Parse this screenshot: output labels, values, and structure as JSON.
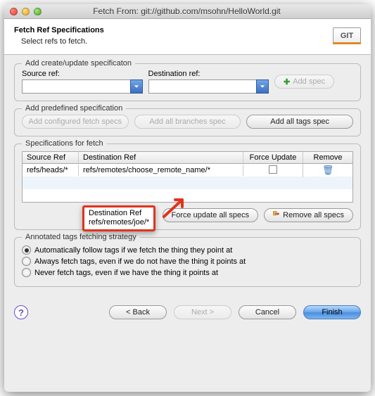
{
  "window": {
    "title": "Fetch From: git://github.com/msohn/HelloWorld.git"
  },
  "header": {
    "title": "Fetch Ref Specifications",
    "subtitle": "Select refs to fetch."
  },
  "groups": {
    "create_update": {
      "label": "Add create/update specificaton",
      "source_ref_label": "Source ref:",
      "destination_ref_label": "Destination ref:",
      "source_ref_value": "",
      "destination_ref_value": "",
      "add_spec_label": "Add spec"
    },
    "predefined": {
      "label": "Add predefined specification",
      "buttons": [
        "Add configured fetch specs",
        "Add all branches spec",
        "Add all tags spec"
      ]
    },
    "specs": {
      "label": "Specifications for fetch",
      "columns": [
        "Source Ref",
        "Destination Ref",
        "Force Update",
        "Remove"
      ],
      "rows": [
        {
          "source": "refs/heads/*",
          "destination": "refs/remotes/choose_remote_name/*",
          "force": false
        }
      ],
      "force_all_label": "Force update all specs",
      "remove_all_label": "Remove all specs"
    },
    "tags": {
      "label": "Annotated tags fetching strategy",
      "options": [
        "Automatically follow tags if we fetch the thing they point at",
        "Always fetch tags, even if we do not have the thing it points at",
        "Never fetch tags, even if we have the thing it points at"
      ],
      "selected": 0
    }
  },
  "callout": {
    "label": "Destination Ref",
    "value": "refs/remotes/joe/*"
  },
  "footer": {
    "back": "< Back",
    "next": "Next >",
    "cancel": "Cancel",
    "finish": "Finish"
  }
}
